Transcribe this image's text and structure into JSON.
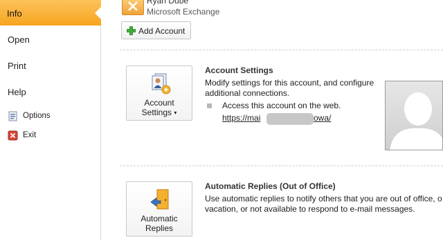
{
  "sidebar": {
    "items": [
      {
        "label": "Info"
      },
      {
        "label": "Open"
      },
      {
        "label": "Print"
      },
      {
        "label": "Help"
      },
      {
        "label": "Options",
        "icon": "options-icon"
      },
      {
        "label": "Exit",
        "icon": "exit-icon"
      }
    ],
    "active": "Info",
    "active_color": "#f7a51f"
  },
  "account": {
    "name": "Ryan Dube",
    "type": "Microsoft Exchange",
    "add_account_label": "Add Account"
  },
  "account_settings": {
    "button_label_line1": "Account",
    "button_label_line2": "Settings",
    "title": "Account Settings",
    "description": "Modify settings for this account, and configure\nadditional connections.",
    "web_access_text": "Access this account on the web.",
    "link_start": "https://mai",
    "link_end": "owa/"
  },
  "automatic_replies": {
    "button_label_line1": "Automatic",
    "button_label_line2": "Replies",
    "title": "Automatic Replies (Out of Office)",
    "description": "Use automatic replies to notify others that you are out of office, o\nvacation, or not available to respond to e-mail messages."
  }
}
